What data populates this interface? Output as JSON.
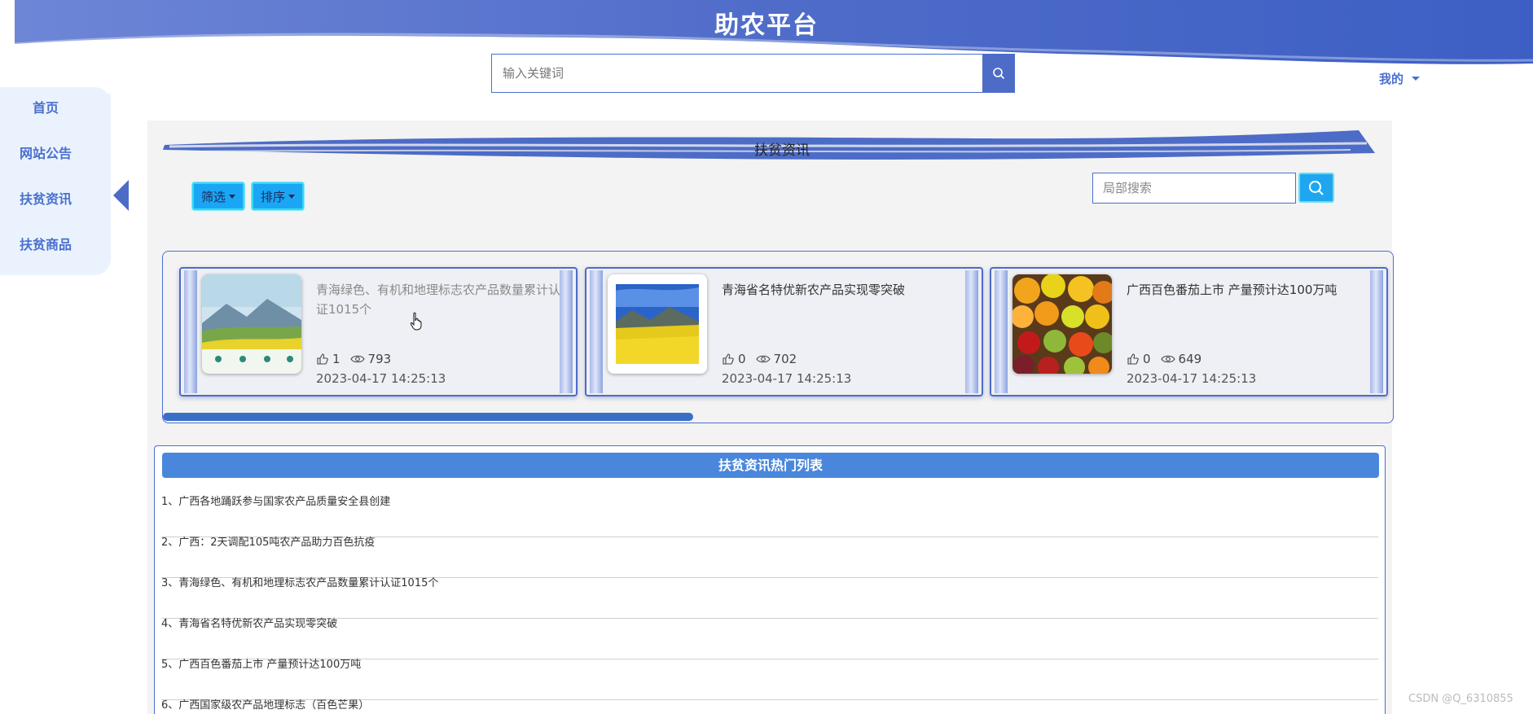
{
  "header": {
    "site_title": "助农平台",
    "search_placeholder": "输入关键词",
    "mine_label": "我的"
  },
  "colors": {
    "brand": "#4d6cc7",
    "accent_button": "#1aa6f5",
    "list_header": "#4a87dc"
  },
  "sidebar": {
    "items": [
      {
        "label": "首页"
      },
      {
        "label": "网站公告"
      },
      {
        "label": "扶贫资讯"
      },
      {
        "label": "扶贫商品"
      }
    ],
    "active_index": 2
  },
  "main": {
    "section_title": "扶贫资讯",
    "filter_label": "筛选",
    "sort_label": "排序",
    "local_search_placeholder": "局部搜索"
  },
  "cards": [
    {
      "title": "青海绿色、有机和地理标志农产品数量累计认证1015个",
      "likes": "1",
      "views": "793",
      "date": "2023-04-17 14:25:13",
      "image": "qinghai-green-poster"
    },
    {
      "title": "青海省名特优新农产品实现零突破",
      "likes": "0",
      "views": "702",
      "date": "2023-04-17 14:25:13",
      "image": "rapeseed-field-landscape"
    },
    {
      "title": "广西百色番茄上市 产量预计达100万吨",
      "likes": "0",
      "views": "649",
      "date": "2023-04-17 14:25:13",
      "image": "fruit-pile"
    }
  ],
  "carousel_scroll_fraction": 0.43,
  "hot_list": {
    "title": "扶贫资讯热门列表",
    "items": [
      "1、广西各地踊跃参与国家农产品质量安全县创建",
      "2、广西：2天调配105吨农产品助力百色抗疫",
      "3、青海绿色、有机和地理标志农产品数量累计认证1015个",
      "4、青海省名特优新农产品实现零突破",
      "5、广西百色番茄上市 产量预计达100万吨",
      "6、广西国家级农产品地理标志（百色芒果）"
    ]
  },
  "watermark": "CSDN @Q_6310855"
}
